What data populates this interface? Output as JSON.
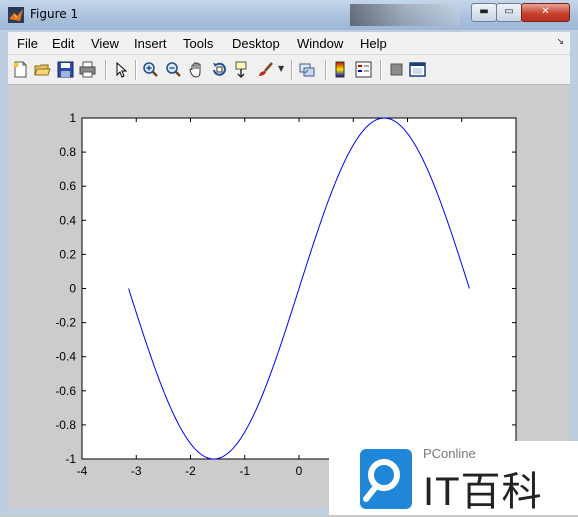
{
  "window": {
    "title": "Figure 1",
    "min_label": "▬",
    "max_label": "▭",
    "close_label": "✕"
  },
  "menu": {
    "items": [
      "File",
      "Edit",
      "View",
      "Insert",
      "Tools",
      "Desktop",
      "Window",
      "Help"
    ],
    "overflow": "↘"
  },
  "toolbar": {
    "icons": [
      "new-figure-icon",
      "open-file-icon",
      "save-icon",
      "print-icon",
      "pointer-icon",
      "zoom-in-icon",
      "zoom-out-icon",
      "pan-icon",
      "rotate-3d-icon",
      "data-cursor-icon",
      "brush-icon",
      "link-plot-icon",
      "colorbar-icon",
      "legend-icon",
      "hide-plot-tools-icon",
      "show-plot-tools-icon"
    ]
  },
  "chart_data": {
    "type": "line",
    "function": "sin(x)",
    "x_range": [
      -3.14159,
      3.14159
    ],
    "xlim": [
      -4,
      4
    ],
    "ylim": [
      -1,
      1
    ],
    "xticks": [
      "-4",
      "-3",
      "-2",
      "-1",
      "0",
      "1",
      "2",
      "3",
      "4"
    ],
    "yticks": [
      "1",
      "0.8",
      "0.6",
      "0.4",
      "0.2",
      "0",
      "-0.2",
      "-0.4",
      "-0.6",
      "-0.8",
      "-1"
    ],
    "series": [
      {
        "color": "#0000ff"
      }
    ],
    "grid": false
  },
  "watermark": {
    "top": "PConline",
    "main": "IT百科"
  }
}
